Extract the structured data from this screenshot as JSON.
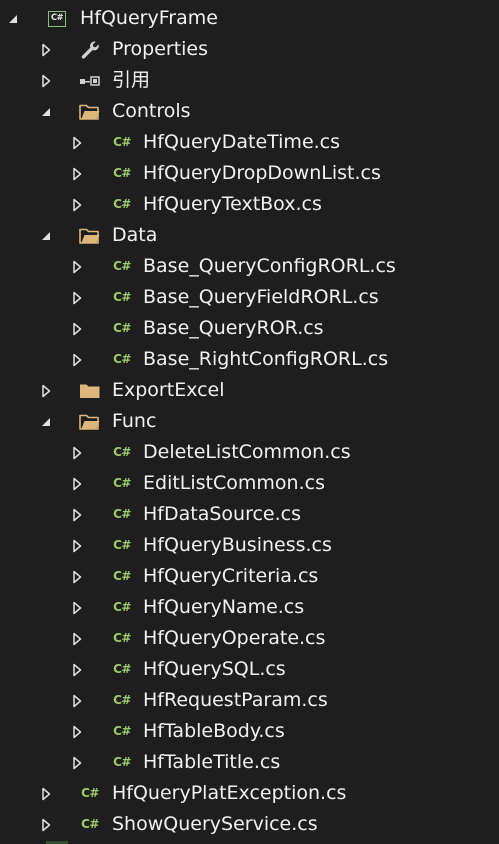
{
  "tree": {
    "project": {
      "label": "HfQueryFrame",
      "icon": "csharp-project-icon",
      "expanded": true
    },
    "items": [
      {
        "label": "Properties",
        "icon": "wrench-icon",
        "expanded": false
      },
      {
        "label": "引用",
        "icon": "references-icon",
        "expanded": false
      },
      {
        "label": "Controls",
        "icon": "folder-open-icon",
        "expanded": true,
        "children": [
          {
            "label": "HfQueryDateTime.cs",
            "icon": "csharp-file-icon"
          },
          {
            "label": "HfQueryDropDownList.cs",
            "icon": "csharp-file-icon"
          },
          {
            "label": "HfQueryTextBox.cs",
            "icon": "csharp-file-icon"
          }
        ]
      },
      {
        "label": "Data",
        "icon": "folder-open-icon",
        "expanded": true,
        "children": [
          {
            "label": "Base_QueryConfigRORL.cs",
            "icon": "csharp-file-icon"
          },
          {
            "label": "Base_QueryFieldRORL.cs",
            "icon": "csharp-file-icon"
          },
          {
            "label": "Base_QueryROR.cs",
            "icon": "csharp-file-icon"
          },
          {
            "label": "Base_RightConfigRORL.cs",
            "icon": "csharp-file-icon"
          }
        ]
      },
      {
        "label": "ExportExcel",
        "icon": "folder-closed-icon",
        "expanded": false
      },
      {
        "label": "Func",
        "icon": "folder-open-icon",
        "expanded": true,
        "children": [
          {
            "label": "DeleteListCommon.cs",
            "icon": "csharp-file-icon"
          },
          {
            "label": "EditListCommon.cs",
            "icon": "csharp-file-icon"
          },
          {
            "label": "HfDataSource.cs",
            "icon": "csharp-file-icon"
          },
          {
            "label": "HfQueryBusiness.cs",
            "icon": "csharp-file-icon"
          },
          {
            "label": "HfQueryCriteria.cs",
            "icon": "csharp-file-icon"
          },
          {
            "label": "HfQueryName.cs",
            "icon": "csharp-file-icon"
          },
          {
            "label": "HfQueryOperate.cs",
            "icon": "csharp-file-icon"
          },
          {
            "label": "HfQuerySQL.cs",
            "icon": "csharp-file-icon"
          },
          {
            "label": "HfRequestParam.cs",
            "icon": "csharp-file-icon"
          },
          {
            "label": "HfTableBody.cs",
            "icon": "csharp-file-icon"
          },
          {
            "label": "HfTableTitle.cs",
            "icon": "csharp-file-icon"
          }
        ]
      },
      {
        "label": "HfQueryPlatException.cs",
        "icon": "csharp-file-icon",
        "expanded": false
      },
      {
        "label": "ShowQueryService.cs",
        "icon": "csharp-file-icon",
        "expanded": false
      }
    ],
    "csharp_badge": "C#",
    "colors": {
      "background": "#1e1e1e",
      "text": "#f1f1f1",
      "csharp_green": "#9ccc65",
      "folder": "#dcb67a",
      "arrow": "#e0e0e0"
    }
  }
}
